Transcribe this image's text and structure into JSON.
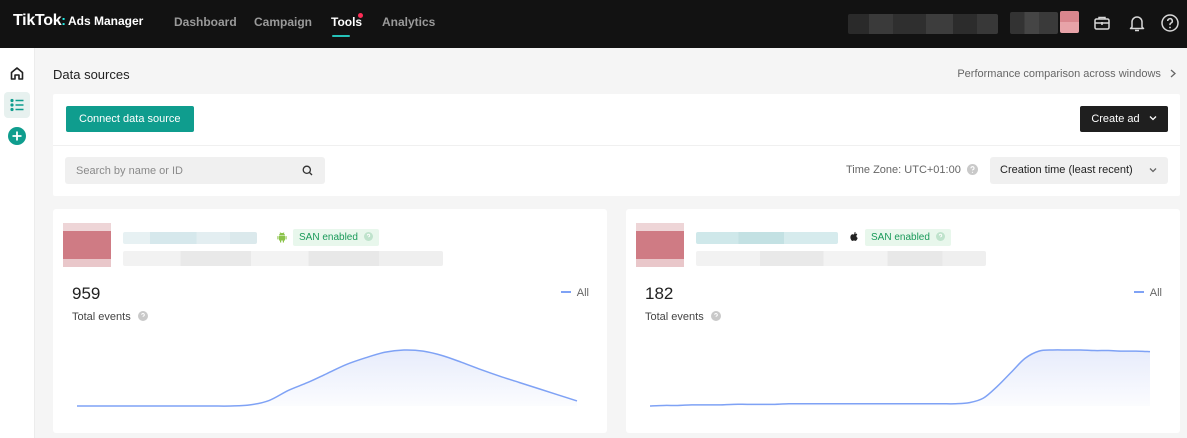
{
  "topbar": {
    "brand": "TikTok",
    "brand_suffix": "Ads Manager",
    "nav": [
      {
        "label": "Dashboard",
        "active": false
      },
      {
        "label": "Campaign",
        "active": false
      },
      {
        "label": "Tools",
        "active": true,
        "notification": true
      },
      {
        "label": "Analytics",
        "active": false
      }
    ],
    "icons": [
      "briefcase-icon",
      "bell-icon",
      "help-icon"
    ]
  },
  "rail": {
    "icons": [
      "home-icon",
      "list-icon",
      "add-icon"
    ],
    "accent": "#0f9d8e"
  },
  "page": {
    "title": "Data sources",
    "perf_link": "Performance comparison across windows"
  },
  "toolbar": {
    "connect_label": "Connect data source",
    "create_label": "Create ad",
    "search_placeholder": "Search by name or ID",
    "timezone": "Time Zone: UTC+01:00",
    "sort_value": "Creation time (least recent)"
  },
  "cards": [
    {
      "platform": "android",
      "badge": "SAN enabled",
      "count": "959",
      "metric_label": "Total events",
      "legend": "All",
      "chart_data": {
        "type": "area",
        "series": [
          {
            "values": [
              0,
              0,
              0,
              0,
              0,
              0,
              0,
              0,
              0,
              0.02,
              0.1,
              0.28,
              0.42,
              0.58,
              0.74,
              0.86,
              0.96,
              1,
              0.98,
              0.9,
              0.78,
              0.65,
              0.53,
              0.42,
              0.31,
              0.2,
              0.09
            ]
          }
        ],
        "grid": false
      }
    },
    {
      "platform": "apple",
      "badge": "SAN enabled",
      "count": "182",
      "metric_label": "Total events",
      "legend": "All",
      "chart_data": {
        "type": "area",
        "series": [
          {
            "values": [
              0,
              0.01,
              0.01,
              0.02,
              0.02,
              0.02,
              0.03,
              0.03,
              0.03,
              0.03,
              0.04,
              0.04,
              0.04,
              0.04,
              0.04,
              0.04,
              0.04,
              0.04,
              0.04,
              0.04,
              0.04,
              0.04,
              0.04,
              0.06,
              0.14,
              0.35,
              0.6,
              0.85,
              0.98,
              1,
              1,
              1,
              0.99,
              0.99,
              0.98,
              0.98,
              0.97
            ]
          }
        ],
        "grid": false
      }
    }
  ],
  "colors": {
    "line": "#7fa2f5",
    "fill": "#e6ebfb",
    "badge_bg": "#e8f7ec",
    "badge_text": "#1a9a5a",
    "connect_button": "#0f9d8e",
    "create_button": "#1f1f1f"
  }
}
